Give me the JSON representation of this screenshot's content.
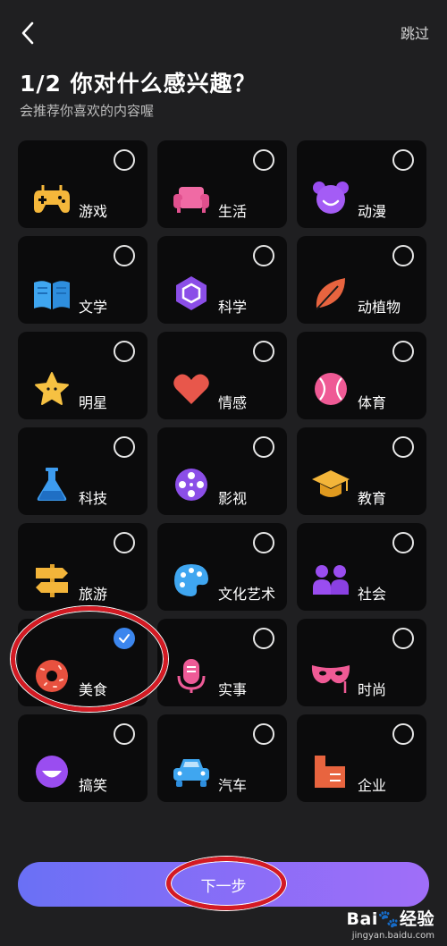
{
  "header": {
    "skip_label": "跳过",
    "title": "1/2 你对什么感兴趣？",
    "subtitle": "会推荐你喜欢的内容喔"
  },
  "categories": [
    {
      "label": "游戏",
      "icon": "gamepad-icon",
      "selected": false
    },
    {
      "label": "生活",
      "icon": "sofa-icon",
      "selected": false
    },
    {
      "label": "动漫",
      "icon": "cartoon-face-icon",
      "selected": false
    },
    {
      "label": "文学",
      "icon": "open-book-icon",
      "selected": false
    },
    {
      "label": "科学",
      "icon": "hexagon-molecule-icon",
      "selected": false
    },
    {
      "label": "动植物",
      "icon": "leaf-icon",
      "selected": false
    },
    {
      "label": "明星",
      "icon": "star-icon",
      "selected": false
    },
    {
      "label": "情感",
      "icon": "heart-icon",
      "selected": false
    },
    {
      "label": "体育",
      "icon": "ball-icon",
      "selected": false
    },
    {
      "label": "科技",
      "icon": "flask-icon",
      "selected": false
    },
    {
      "label": "影视",
      "icon": "film-reel-icon",
      "selected": false
    },
    {
      "label": "教育",
      "icon": "graduation-cap-icon",
      "selected": false
    },
    {
      "label": "旅游",
      "icon": "signpost-icon",
      "selected": false
    },
    {
      "label": "文化艺术",
      "icon": "palette-icon",
      "selected": false
    },
    {
      "label": "社会",
      "icon": "people-icon",
      "selected": false
    },
    {
      "label": "美食",
      "icon": "donut-icon",
      "selected": true
    },
    {
      "label": "实事",
      "icon": "microphone-icon",
      "selected": false
    },
    {
      "label": "时尚",
      "icon": "mask-icon",
      "selected": false
    },
    {
      "label": "搞笑",
      "icon": "laughing-face-icon",
      "selected": false
    },
    {
      "label": "汽车",
      "icon": "car-icon",
      "selected": false
    },
    {
      "label": "企业",
      "icon": "building-icon",
      "selected": false
    }
  ],
  "footer": {
    "next_label": "下一步"
  },
  "watermark": {
    "logo": "Bai🐾经验",
    "url": "jingyan.baidu.com"
  },
  "colors": {
    "background": "#1f1f21",
    "card": "#0b0b0c",
    "check": "#3c86ee",
    "button_start": "#6a70f5",
    "button_end": "#a06ef8",
    "annotation": "#d41a23"
  }
}
